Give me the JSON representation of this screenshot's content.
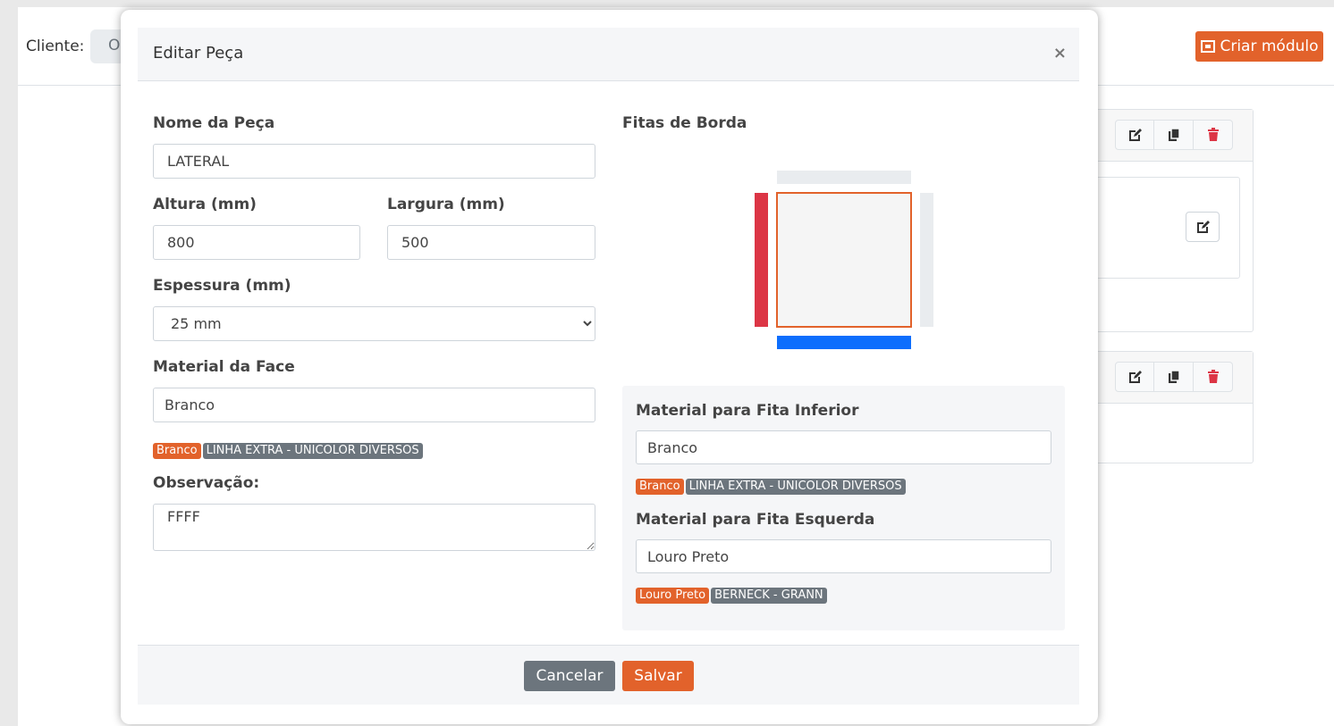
{
  "background": {
    "cliente_label": "Cliente:",
    "cliente_value": "O",
    "criar_modulo_label": "Criar módulo"
  },
  "modal": {
    "title": "Editar Peça",
    "close_label": "×",
    "nome_label": "Nome da Peça",
    "nome_value": "LATERAL",
    "altura_label": "Altura (mm)",
    "altura_value": "800",
    "largura_label": "Largura (mm)",
    "largura_value": "500",
    "espessura_label": "Espessura (mm)",
    "espessura_value": "25 mm",
    "material_face_label": "Material da Face",
    "material_face_value": "Branco",
    "material_face_badges": [
      "Branco",
      "LINHA EXTRA - UNICOLOR DIVERSOS"
    ],
    "observacao_label": "Observação:",
    "observacao_value": "FFFF",
    "fitas_label": "Fitas de Borda",
    "fita_inferior_label": "Material para Fita Inferior",
    "fita_inferior_value": "Branco",
    "fita_inferior_badges": [
      "Branco",
      "LINHA EXTRA - UNICOLOR DIVERSOS"
    ],
    "fita_esquerda_label": "Material para Fita Esquerda",
    "fita_esquerda_value": "Louro Preto",
    "fita_esquerda_badges": [
      "Louro Preto",
      "BERNECK - GRANN"
    ],
    "cancel_label": "Cancelar",
    "save_label": "Salvar"
  },
  "colors": {
    "accent": "#e2622b",
    "secondary": "#6c757d",
    "edge_left": "#dc3545",
    "edge_bottom": "#0d6efd",
    "edge_inactive": "#e9ecef",
    "delete": "#dc3545"
  }
}
